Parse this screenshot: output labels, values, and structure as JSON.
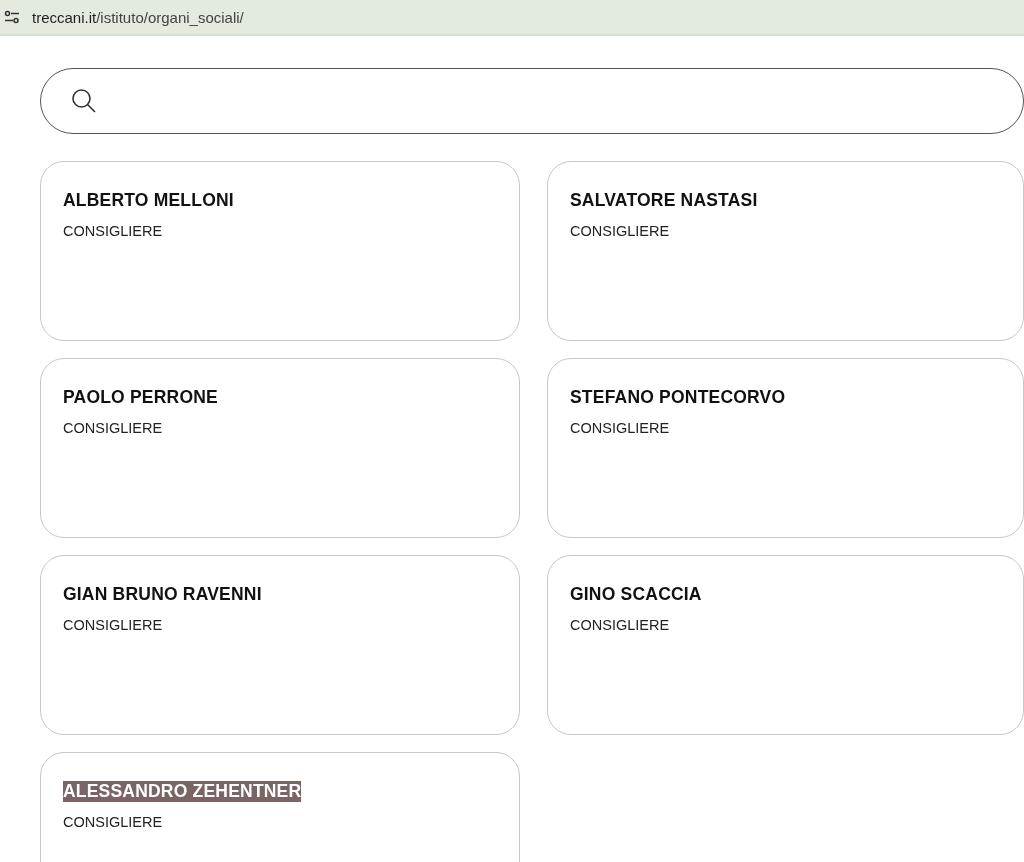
{
  "address_bar": {
    "url_host": "treccani.it",
    "url_path": "/istituto/organi_sociali/"
  },
  "members": [
    {
      "name": "ALBERTO MELLONI",
      "role": "CONSIGLIERE",
      "highlighted": false
    },
    {
      "name": "SALVATORE NASTASI",
      "role": "CONSIGLIERE",
      "highlighted": false
    },
    {
      "name": "PAOLO PERRONE",
      "role": "CONSIGLIERE",
      "highlighted": false
    },
    {
      "name": "STEFANO PONTECORVO",
      "role": "CONSIGLIERE",
      "highlighted": false
    },
    {
      "name": "GIAN BRUNO RAVENNI",
      "role": "CONSIGLIERE",
      "highlighted": false
    },
    {
      "name": "GINO SCACCIA",
      "role": "CONSIGLIERE",
      "highlighted": false
    },
    {
      "name": "ALESSANDRO ZEHENTNER",
      "role": "CONSIGLIERE",
      "highlighted": true
    }
  ]
}
